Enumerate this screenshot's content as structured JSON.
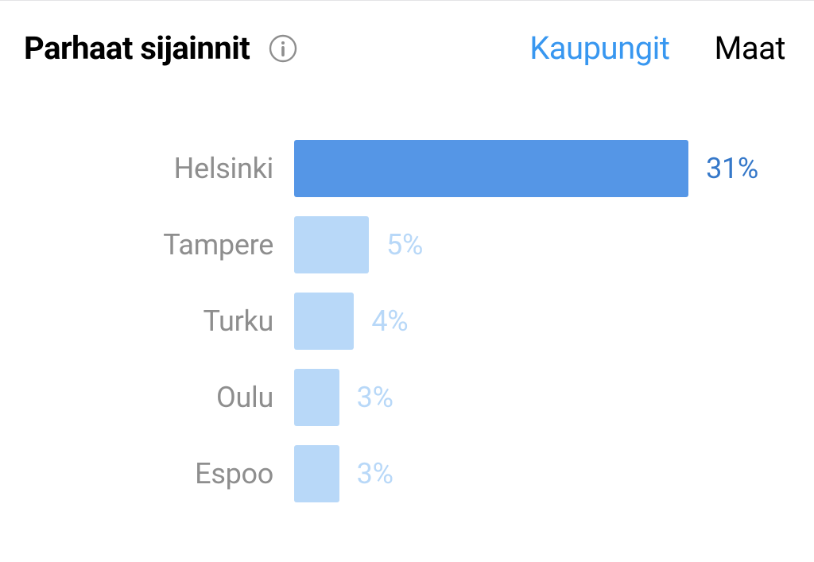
{
  "header": {
    "title": "Parhaat sijainnit",
    "tabs": {
      "cities": "Kaupungit",
      "countries": "Maat"
    }
  },
  "chart_data": {
    "type": "bar",
    "orientation": "horizontal",
    "title": "Parhaat sijainnit",
    "categories": [
      "Helsinki",
      "Tampere",
      "Turku",
      "Oulu",
      "Espoo"
    ],
    "values": [
      31,
      5,
      4,
      3,
      3
    ],
    "value_suffix": "%",
    "rows": [
      {
        "label": "Helsinki",
        "value": 31,
        "bar_pct": 100,
        "bar_color": "#5596e6",
        "text_color": "#3578c9"
      },
      {
        "label": "Tampere",
        "value": 5,
        "bar_pct": 16.1,
        "bar_color": "#b8d8f8",
        "text_color": "#b8d8f8"
      },
      {
        "label": "Turku",
        "value": 4,
        "bar_pct": 12.9,
        "bar_color": "#b8d8f8",
        "text_color": "#b8d8f8"
      },
      {
        "label": "Oulu",
        "value": 3,
        "bar_pct": 9.7,
        "bar_color": "#b8d8f8",
        "text_color": "#b8d8f8"
      },
      {
        "label": "Espoo",
        "value": 3,
        "bar_pct": 9.7,
        "bar_color": "#b8d8f8",
        "text_color": "#b8d8f8"
      }
    ]
  }
}
